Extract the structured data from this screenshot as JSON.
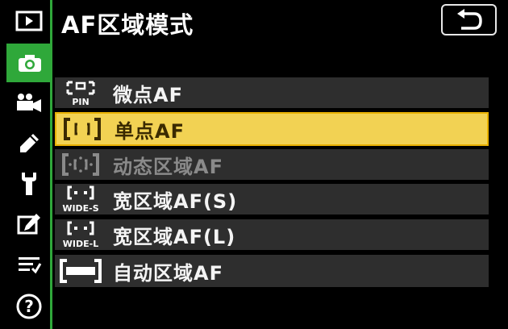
{
  "header": {
    "title": "AF区域模式",
    "back_icon": "return-icon"
  },
  "sidebar": {
    "tabs": [
      {
        "name": "playback-menu",
        "icon": "play-icon",
        "active": false
      },
      {
        "name": "photo-shooting-menu",
        "icon": "camera-icon",
        "active": true
      },
      {
        "name": "movie-shooting-menu",
        "icon": "movie-camera-icon",
        "active": false
      },
      {
        "name": "custom-settings-menu",
        "icon": "pencil-icon",
        "active": false
      },
      {
        "name": "setup-menu",
        "icon": "wrench-icon",
        "active": false
      },
      {
        "name": "retouch-menu",
        "icon": "retouch-icon",
        "active": false
      },
      {
        "name": "my-menu",
        "icon": "my-menu-icon",
        "active": false
      },
      {
        "name": "help",
        "icon": "help-icon",
        "active": false
      }
    ]
  },
  "menu": {
    "items": [
      {
        "label": "微点AF",
        "icon": "pinpoint-af-icon",
        "icon_text": "PIN",
        "state": "normal"
      },
      {
        "label": "单点AF",
        "icon": "single-point-af-icon",
        "state": "selected"
      },
      {
        "label": "动态区域AF",
        "icon": "dynamic-area-af-icon",
        "state": "disabled"
      },
      {
        "label": "宽区域AF(S)",
        "icon": "wide-area-s-icon",
        "icon_text": "WIDE-S",
        "state": "normal"
      },
      {
        "label": "宽区域AF(L)",
        "icon": "wide-area-l-icon",
        "icon_text": "WIDE-L",
        "state": "normal"
      },
      {
        "label": "自动区域AF",
        "icon": "auto-area-af-icon",
        "state": "normal"
      }
    ]
  },
  "colors": {
    "accent_green": "#2fa83a",
    "selection_yellow": "#f2d253",
    "row_gray": "#2e2e2e"
  }
}
